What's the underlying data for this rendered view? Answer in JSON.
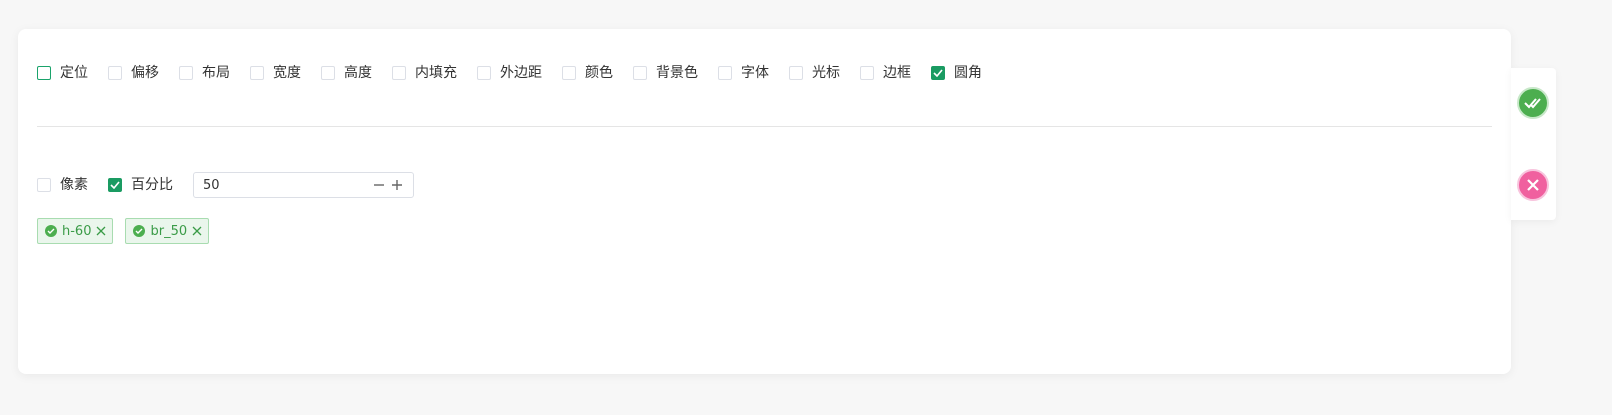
{
  "property_checkboxes": [
    {
      "label": "定位",
      "checked": false,
      "focused": true
    },
    {
      "label": "偏移",
      "checked": false
    },
    {
      "label": "布局",
      "checked": false
    },
    {
      "label": "宽度",
      "checked": false
    },
    {
      "label": "高度",
      "checked": false
    },
    {
      "label": "内填充",
      "checked": false
    },
    {
      "label": "外边距",
      "checked": false
    },
    {
      "label": "颜色",
      "checked": false
    },
    {
      "label": "背景色",
      "checked": false
    },
    {
      "label": "字体",
      "checked": false
    },
    {
      "label": "光标",
      "checked": false
    },
    {
      "label": "边框",
      "checked": false
    },
    {
      "label": "圆角",
      "checked": true
    }
  ],
  "units": [
    {
      "label": "像素",
      "checked": false
    },
    {
      "label": "百分比",
      "checked": true
    }
  ],
  "number_input": {
    "value": "50"
  },
  "tags": [
    {
      "label": "h-60"
    },
    {
      "label": "br_50"
    }
  ],
  "colors": {
    "accent": "#1a9b62",
    "confirm": "#4cae4f",
    "cancel": "#f0609f",
    "tag_text": "#3a9b47",
    "tag_bg": "#eaf6ec"
  }
}
